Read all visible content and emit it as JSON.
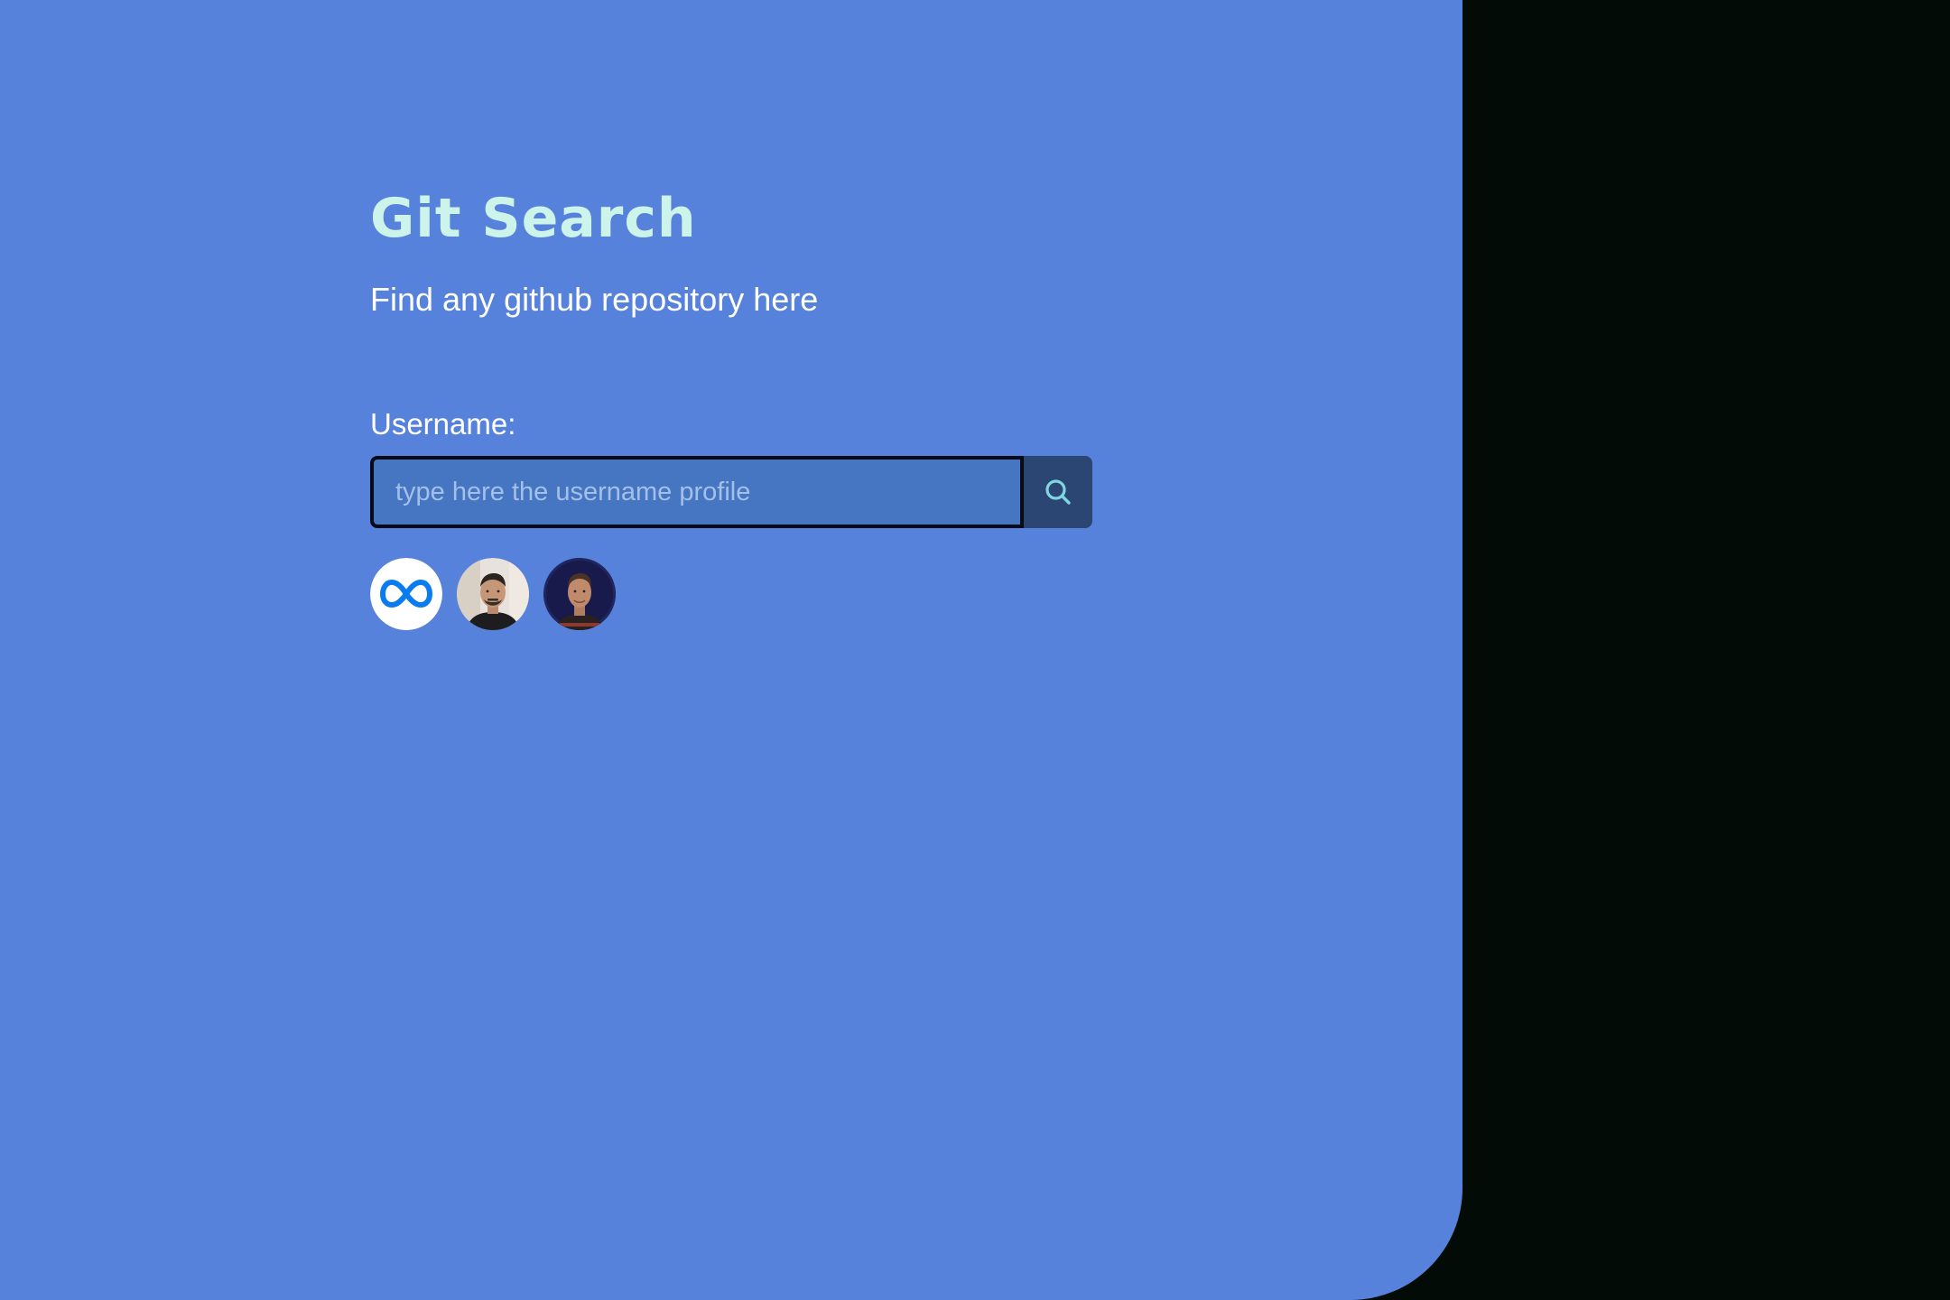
{
  "app": {
    "title": "Git Search",
    "subtitle": "Find any github repository here"
  },
  "search": {
    "label": "Username:",
    "placeholder": "type here the username profile",
    "value": "",
    "button_icon": "search-icon"
  },
  "suggestions": [
    {
      "icon": "meta-logo-icon"
    },
    {
      "icon": "user-avatar"
    },
    {
      "icon": "user-avatar"
    }
  ],
  "colors": {
    "panel_background": "#5782db",
    "page_background": "#020b06",
    "title": "#cdf4ea",
    "input_background": "#4675c1",
    "button_background": "#2c4673",
    "search_icon": "#7fd6e0",
    "meta_blue": "#0a7cf0"
  }
}
